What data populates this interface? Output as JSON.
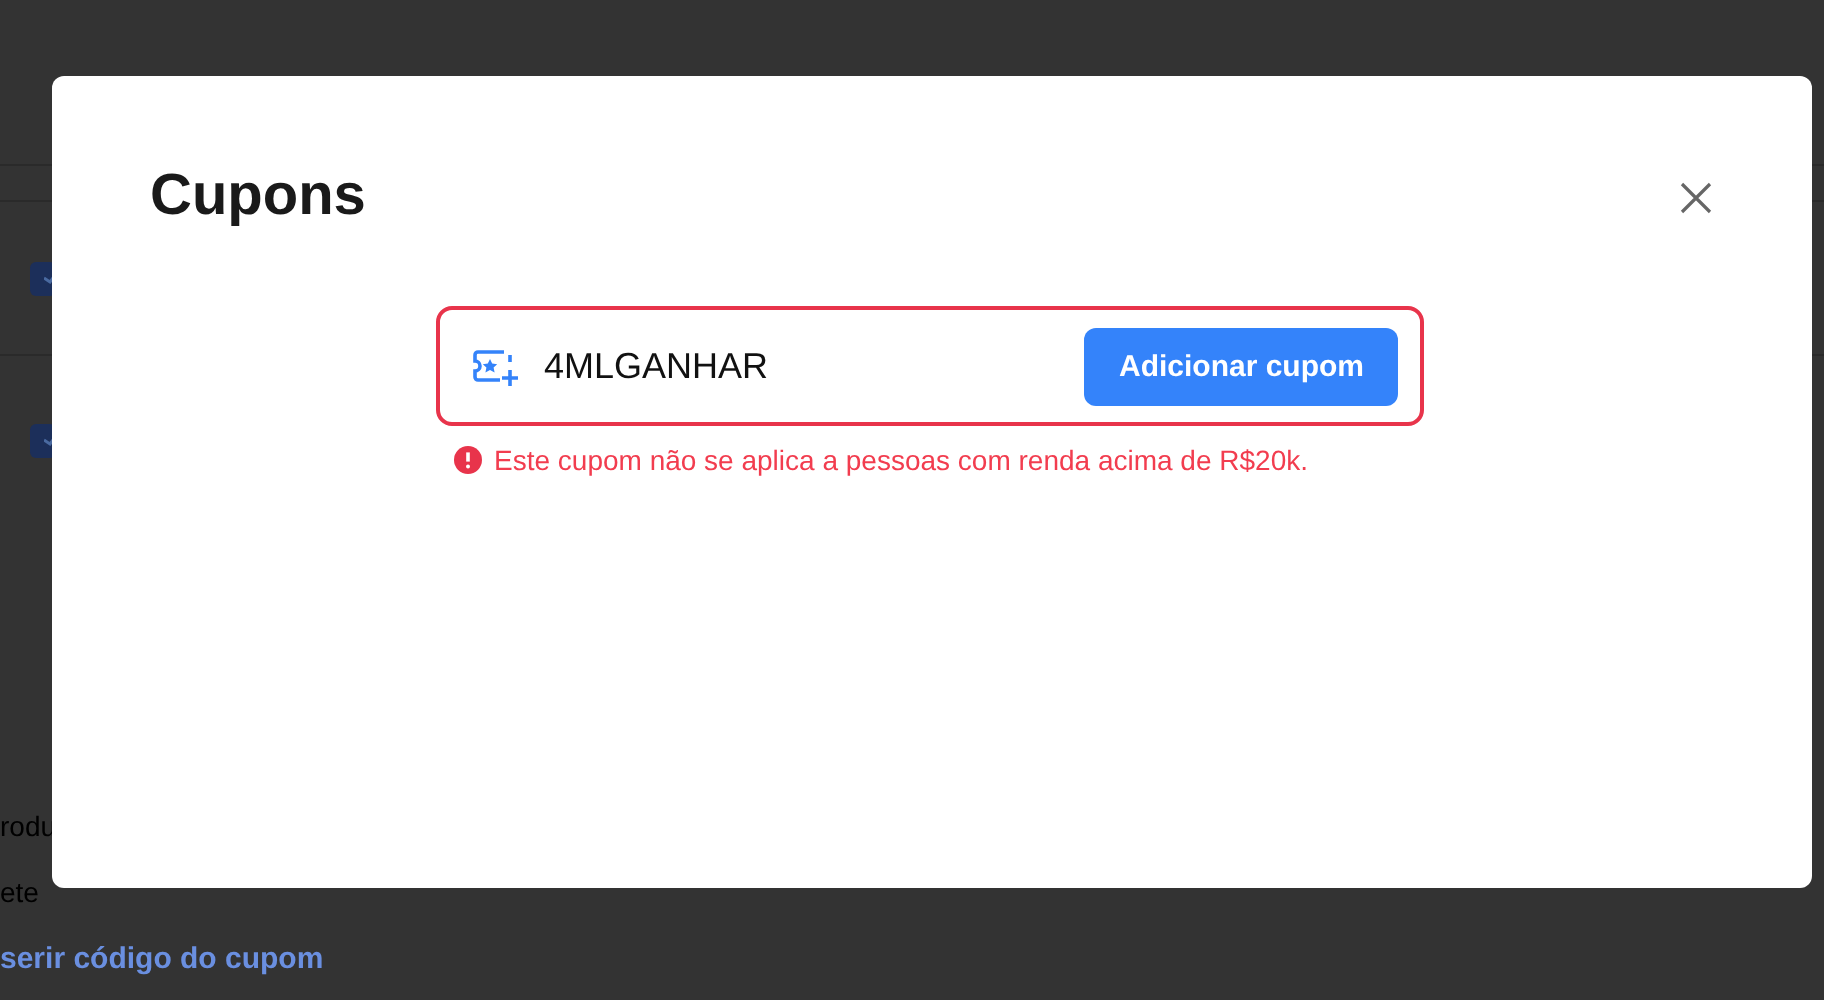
{
  "background_page": {
    "checkboxes": [
      {
        "checked": true
      },
      {
        "checked": true
      }
    ],
    "texts": [
      "rodu",
      "ete"
    ],
    "link": "serir código do cupom"
  },
  "dialog": {
    "title": "Cupons",
    "coupon_field": {
      "value": "4MLGANHAR",
      "invalid": true
    },
    "add_button": "Adicionar cupom",
    "error": "Este cupom não se aplica a pessoas com renda acima de R$20k."
  }
}
